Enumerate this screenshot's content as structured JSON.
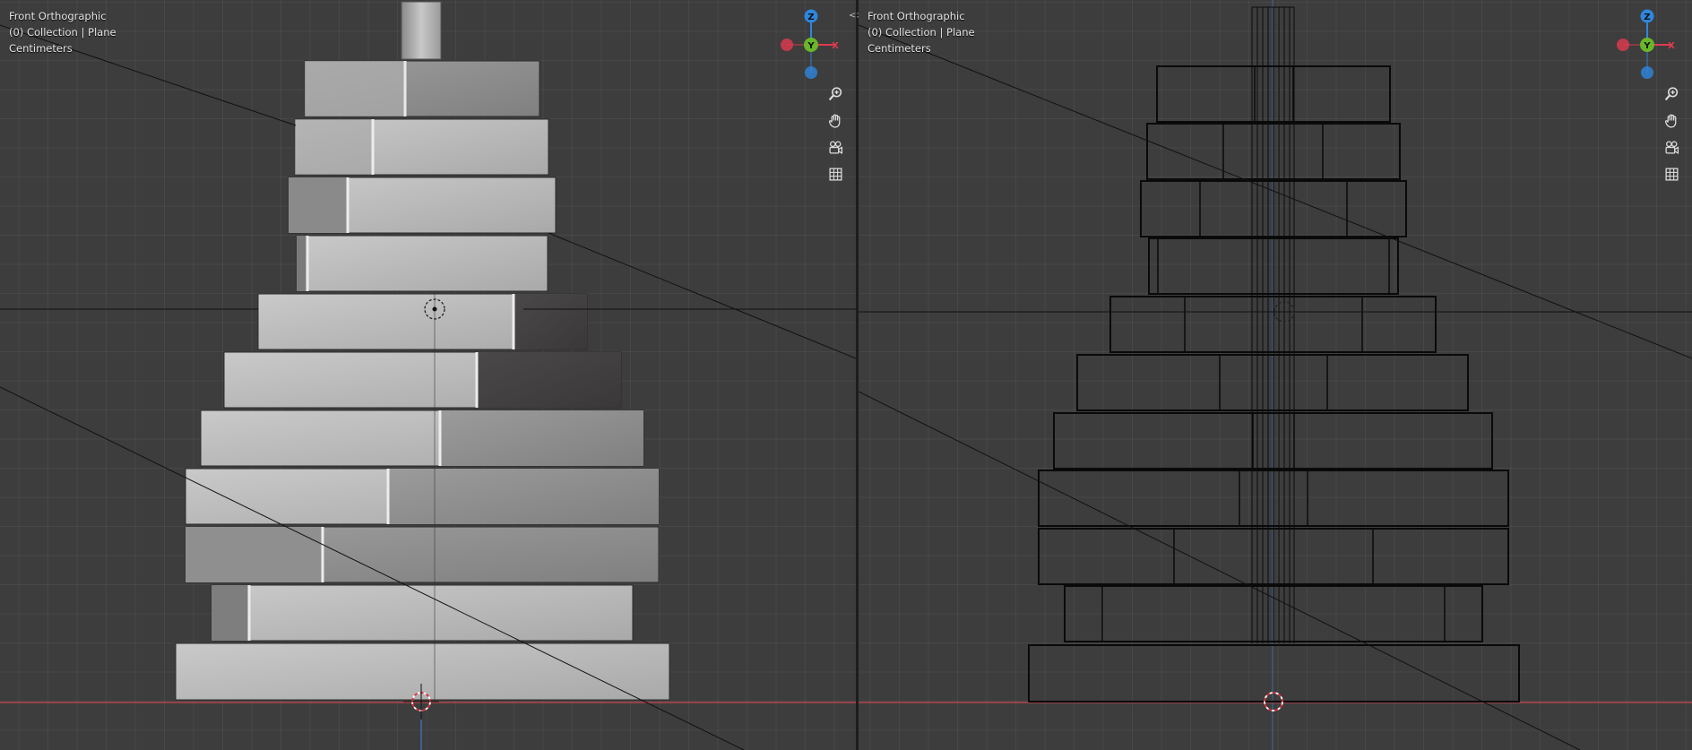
{
  "left_viewport": {
    "view_name": "Front Orthographic",
    "collection_info": "(0) Collection | Plane",
    "units": "Centimeters",
    "shading": "solid"
  },
  "right_viewport": {
    "view_name": "Front Orthographic",
    "collection_info": "(0) Collection | Plane",
    "units": "Centimeters",
    "shading": "wireframe"
  },
  "gizmo": {
    "z_label": "Z",
    "y_label": "Y",
    "x_label": "X"
  },
  "tools": [
    "zoom-icon",
    "hand-pan-icon",
    "camera-icon",
    "grid-perspective-icon"
  ],
  "colors": {
    "x_axis": "#e03a4f",
    "y_axis": "#6ab62a",
    "z_axis": "#2e86de",
    "background": "#3d3d3d",
    "wire": "#0a0a0a"
  }
}
